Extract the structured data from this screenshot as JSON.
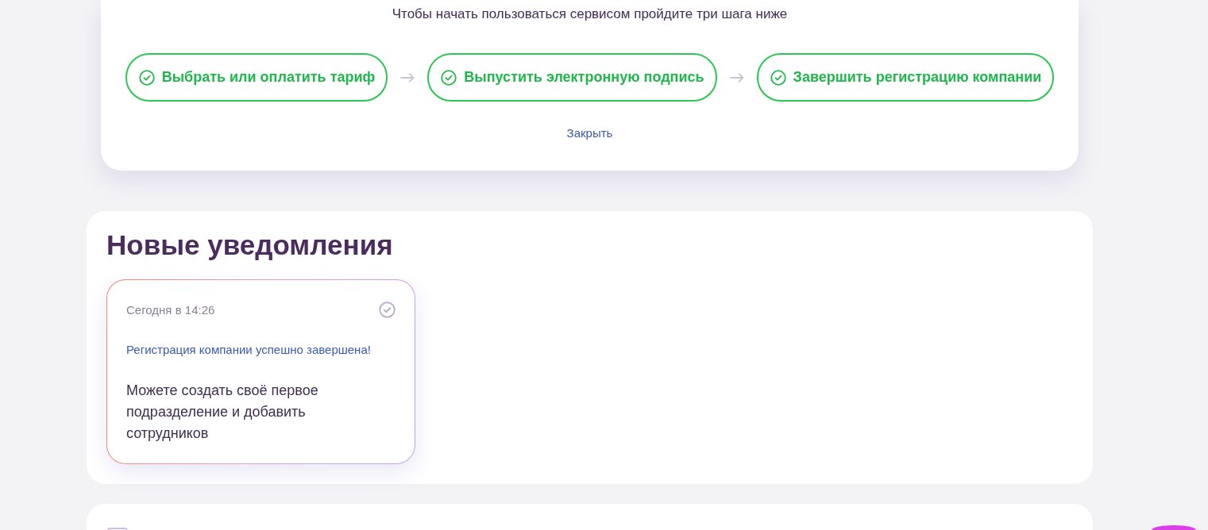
{
  "onboarding": {
    "intro": "Чтобы начать пользоваться сервисом пройдите три шага ниже",
    "steps": [
      {
        "label": "Выбрать или оплатить тариф",
        "done": true
      },
      {
        "label": "Выпустить электронную подпись",
        "done": true
      },
      {
        "label": "Завершить регистрацию компании",
        "done": true
      }
    ],
    "close_link": "Закрыть"
  },
  "notifications": {
    "title": "Новые уведомления",
    "items": [
      {
        "time": "Сегодня в 14:26",
        "title": "Регистрация компании успешно завершена!",
        "body": "Можете создать своё первое подразделение и добавить сотрудников"
      }
    ]
  }
}
